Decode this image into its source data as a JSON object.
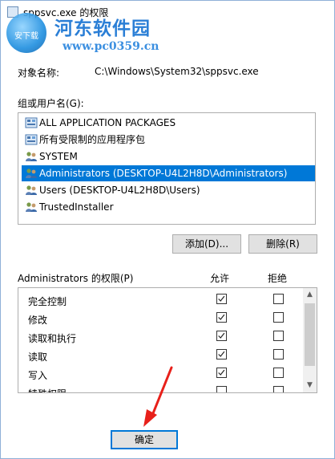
{
  "window": {
    "title": "sppsvc.exe 的权限",
    "icon": "file-icon"
  },
  "watermark": {
    "site_name": "河东软件园",
    "url": "www.pc0359.cn",
    "logo_text": "安下载"
  },
  "object": {
    "label": "对象名称:",
    "value": "C:\\Windows\\System32\\sppsvc.exe"
  },
  "groups": {
    "label": "组或用户名(G):",
    "items": [
      {
        "label": "ALL APPLICATION PACKAGES",
        "icon": "app-package-icon",
        "selected": false
      },
      {
        "label": "所有受限制的应用程序包",
        "icon": "app-package-icon",
        "selected": false
      },
      {
        "label": "SYSTEM",
        "icon": "user-group-icon",
        "selected": false
      },
      {
        "label": "Administrators (DESKTOP-U4L2H8D\\Administrators)",
        "icon": "user-group-icon",
        "selected": true
      },
      {
        "label": "Users (DESKTOP-U4L2H8D\\Users)",
        "icon": "user-group-icon",
        "selected": false
      },
      {
        "label": "TrustedInstaller",
        "icon": "user-group-icon",
        "selected": false
      }
    ]
  },
  "buttons": {
    "add": "添加(D)...",
    "remove": "删除(R)",
    "ok": "确定"
  },
  "permissions": {
    "header": "Administrators 的权限(P)",
    "allow_label": "允许",
    "deny_label": "拒绝",
    "rows": [
      {
        "name": "完全控制",
        "allow": true,
        "deny": false
      },
      {
        "name": "修改",
        "allow": true,
        "deny": false
      },
      {
        "name": "读取和执行",
        "allow": true,
        "deny": false
      },
      {
        "name": "读取",
        "allow": true,
        "deny": false
      },
      {
        "name": "写入",
        "allow": true,
        "deny": false
      },
      {
        "name": "特殊权限",
        "allow": false,
        "deny": false
      }
    ]
  },
  "colors": {
    "selection": "#0078d7",
    "annotation_arrow": "#e8201a"
  }
}
